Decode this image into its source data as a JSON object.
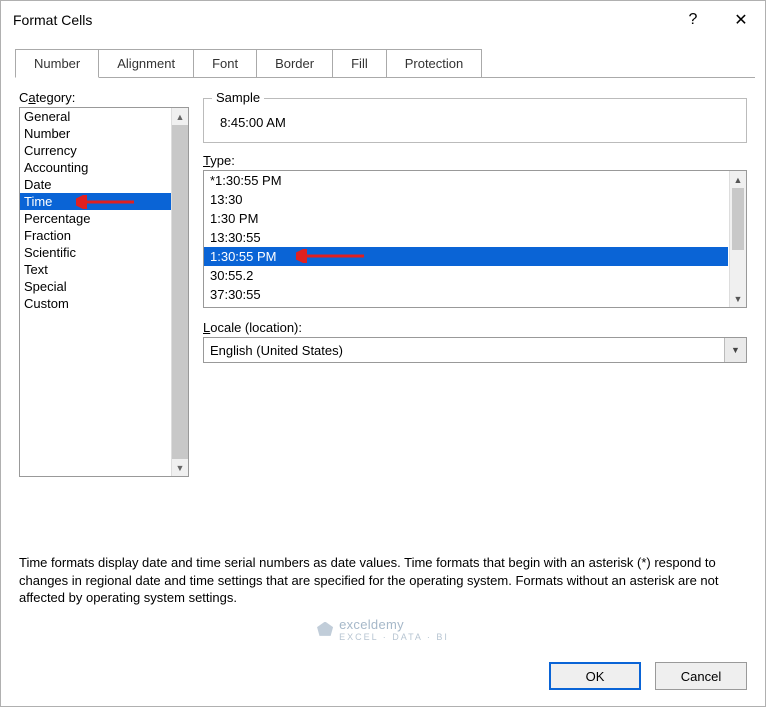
{
  "title": "Format Cells",
  "titlebar": {
    "help": "?",
    "close": "✕"
  },
  "tabs": [
    "Number",
    "Alignment",
    "Font",
    "Border",
    "Fill",
    "Protection"
  ],
  "active_tab": 0,
  "category": {
    "label_pre": "C",
    "label_u": "a",
    "label_post": "tegory:",
    "items": [
      "General",
      "Number",
      "Currency",
      "Accounting",
      "Date",
      "Time",
      "Percentage",
      "Fraction",
      "Scientific",
      "Text",
      "Special",
      "Custom"
    ],
    "selected_index": 5
  },
  "sample": {
    "label": "Sample",
    "value": "8:45:00 AM"
  },
  "type": {
    "label_u": "T",
    "label_post": "ype:",
    "items": [
      "*1:30:55 PM",
      "13:30",
      "1:30 PM",
      "13:30:55",
      "1:30:55 PM",
      "30:55.2",
      "37:30:55"
    ],
    "selected_index": 4
  },
  "locale": {
    "label_u": "L",
    "label_post": "ocale (location):",
    "value": "English (United States)"
  },
  "description": "Time formats display date and time serial numbers as date values.  Time formats that begin with an asterisk (*) respond to changes in regional date and time settings that are specified for the operating system. Formats without an asterisk are not affected by operating system settings.",
  "watermark": {
    "brand": "exceldemy",
    "tagline": "EXCEL · DATA · BI"
  },
  "buttons": {
    "ok": "OK",
    "cancel": "Cancel"
  }
}
